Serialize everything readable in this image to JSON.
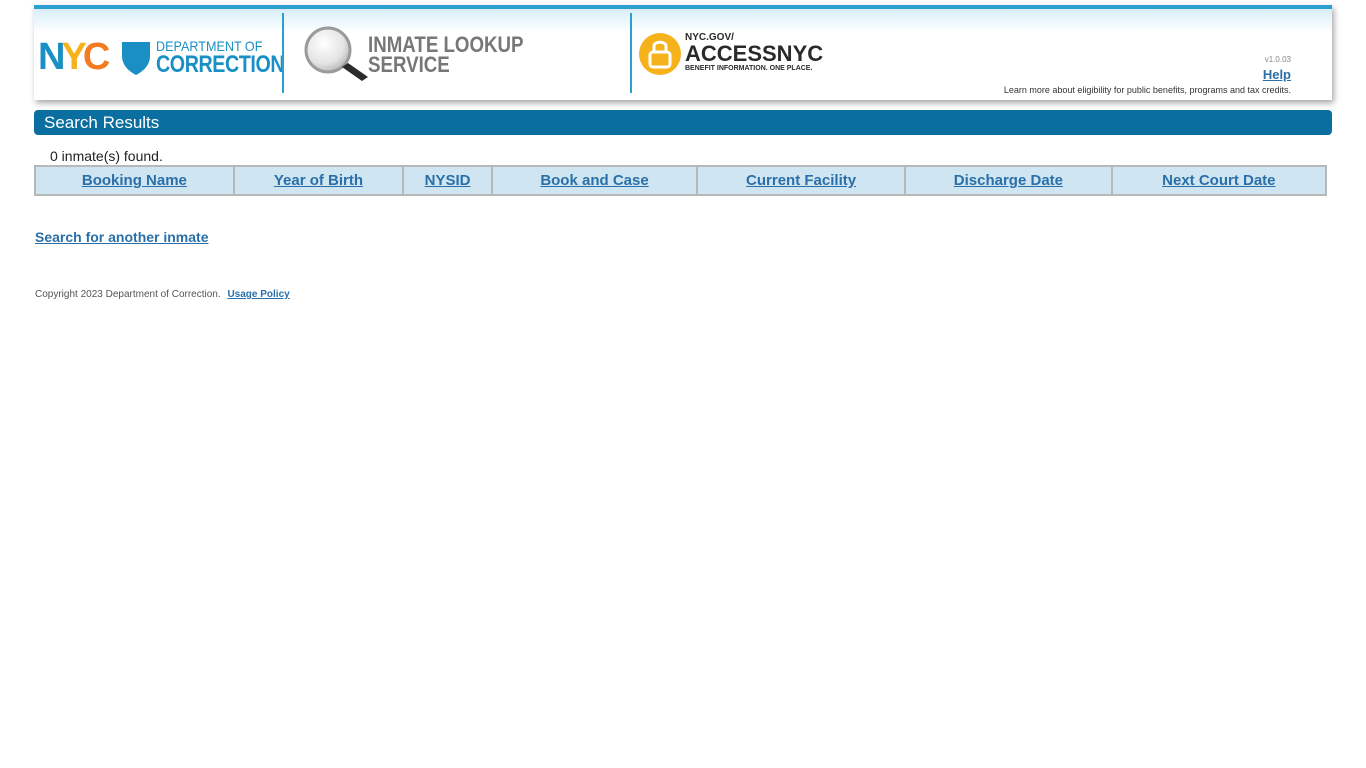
{
  "header": {
    "nyc_logo_text": "NYC",
    "dept_line1": "DEPARTMENT OF",
    "dept_line2": "CORRECTION",
    "service_line1": "INMATE LOOKUP",
    "service_line2": "SERVICE",
    "access_small": "NYC.GOV/",
    "access_big": "ACCESSNYC",
    "access_tagline": "BENEFIT INFORMATION. ONE PLACE.",
    "version": "v1.0.03",
    "help_label": "Help",
    "learn_text": "Learn more about eligibility for public benefits, programs and tax credits.",
    "colors": {
      "accent": "#2a9fd0",
      "access_yellow": "#f6b21b",
      "nyc_orange": "#f47b20"
    }
  },
  "results": {
    "title": "Search Results",
    "count_text": "0 inmate(s) found.",
    "columns": [
      "Booking Name",
      "Year of Birth",
      "NYSID",
      "Book and Case",
      "Current Facility",
      "Discharge Date",
      "Next Court Date"
    ],
    "rows": []
  },
  "search_again_label": "Search for another inmate",
  "footer": {
    "copyright": "Copyright 2023 Department of Correction.",
    "usage_label": "Usage Policy"
  }
}
